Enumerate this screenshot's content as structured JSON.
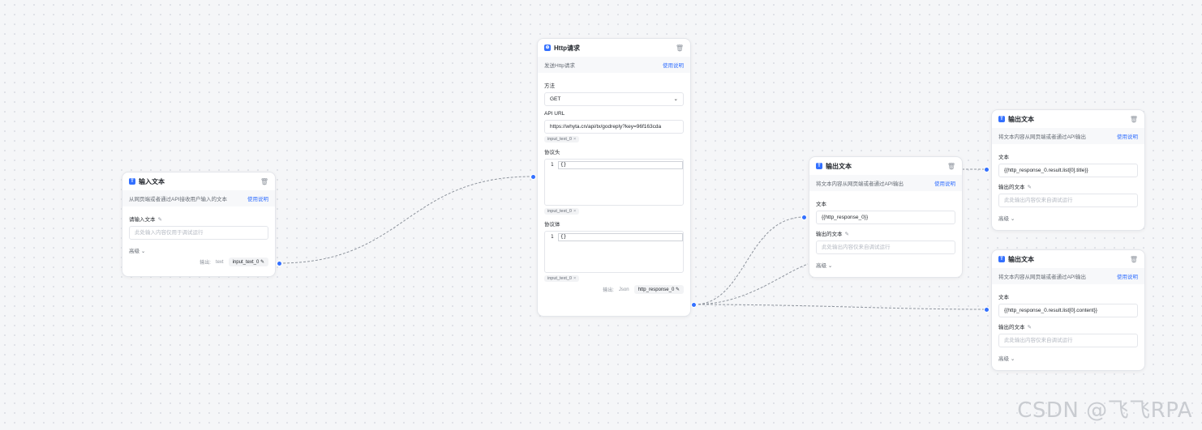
{
  "input_node": {
    "title": "输入文本",
    "desc": "从网页端或者通过API接收用户输入的文本",
    "help": "使用说明",
    "field_label": "请输入文本",
    "placeholder": "此处输入内容仅用于调试运行",
    "advanced": "高级",
    "output_label": "输出:",
    "output_type": "text",
    "output_var": "input_text_0"
  },
  "http_node": {
    "title": "Http请求",
    "desc": "发送Http请求",
    "help": "使用说明",
    "method_label": "方法",
    "method_value": "GET",
    "url_label": "API URL",
    "url_value": "https://whyta.cn/api/tx/godreply?key=96f163cda",
    "url_tag": "input_text_0",
    "headers_label": "协议头",
    "headers_line": "1",
    "headers_code": "{}",
    "headers_tag": "input_text_0",
    "body_label": "协议体",
    "body_line": "1",
    "body_code": "{}",
    "body_tag": "input_text_0",
    "output_label": "输出:",
    "output_type": "Json",
    "output_var": "http_response_0"
  },
  "output_nodes": [
    {
      "title": "输出文本",
      "desc": "将文本内容从网页端或者通过API输出",
      "help": "使用说明",
      "text_label": "文本",
      "text_value": "{{http_response_0}}",
      "out_label": "输出的文本",
      "out_placeholder": "此处输出内容仅来自调试运行",
      "advanced": "高级"
    },
    {
      "title": "输出文本",
      "desc": "将文本内容从网页端或者通过API输出",
      "help": "使用说明",
      "text_label": "文本",
      "text_value": "{{http_response_0.result.list[0].title}}",
      "out_label": "输出的文本",
      "out_placeholder": "此处输出内容仅来自调试运行",
      "advanced": "高级"
    },
    {
      "title": "输出文本",
      "desc": "将文本内容从网页端或者通过API输出",
      "help": "使用说明",
      "text_label": "文本",
      "text_value": "{{http_response_0.result.list[0].content}}",
      "out_label": "输出的文本",
      "out_placeholder": "此处输出内容仅来自调试运行",
      "advanced": "高级"
    }
  ],
  "watermark": "CSDN @飞飞RPA",
  "colors": {
    "accent": "#3370ff",
    "edge": "#8f959e"
  }
}
